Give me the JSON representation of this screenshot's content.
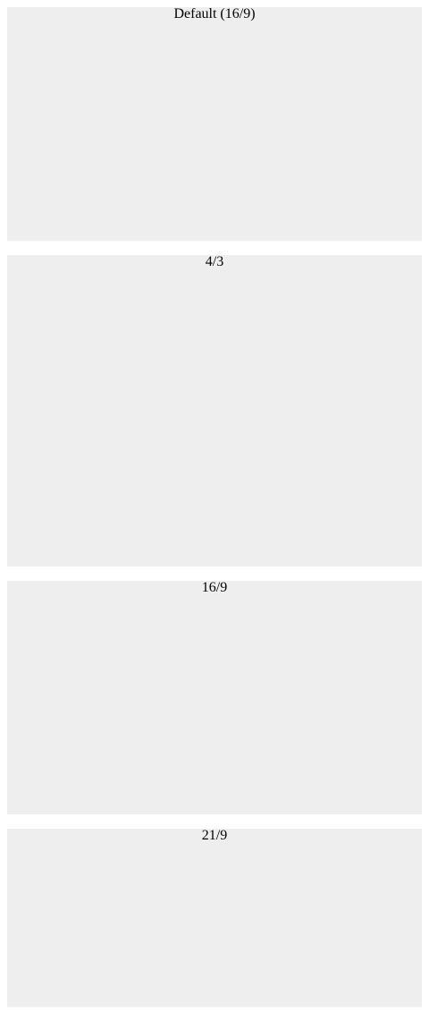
{
  "boxes": [
    {
      "label": "Default (16/9)"
    },
    {
      "label": "4/3"
    },
    {
      "label": "16/9"
    },
    {
      "label": "21/9"
    }
  ],
  "colors": {
    "box_background": "#eeeeee",
    "page_background": "#ffffff",
    "text": "#000000"
  }
}
